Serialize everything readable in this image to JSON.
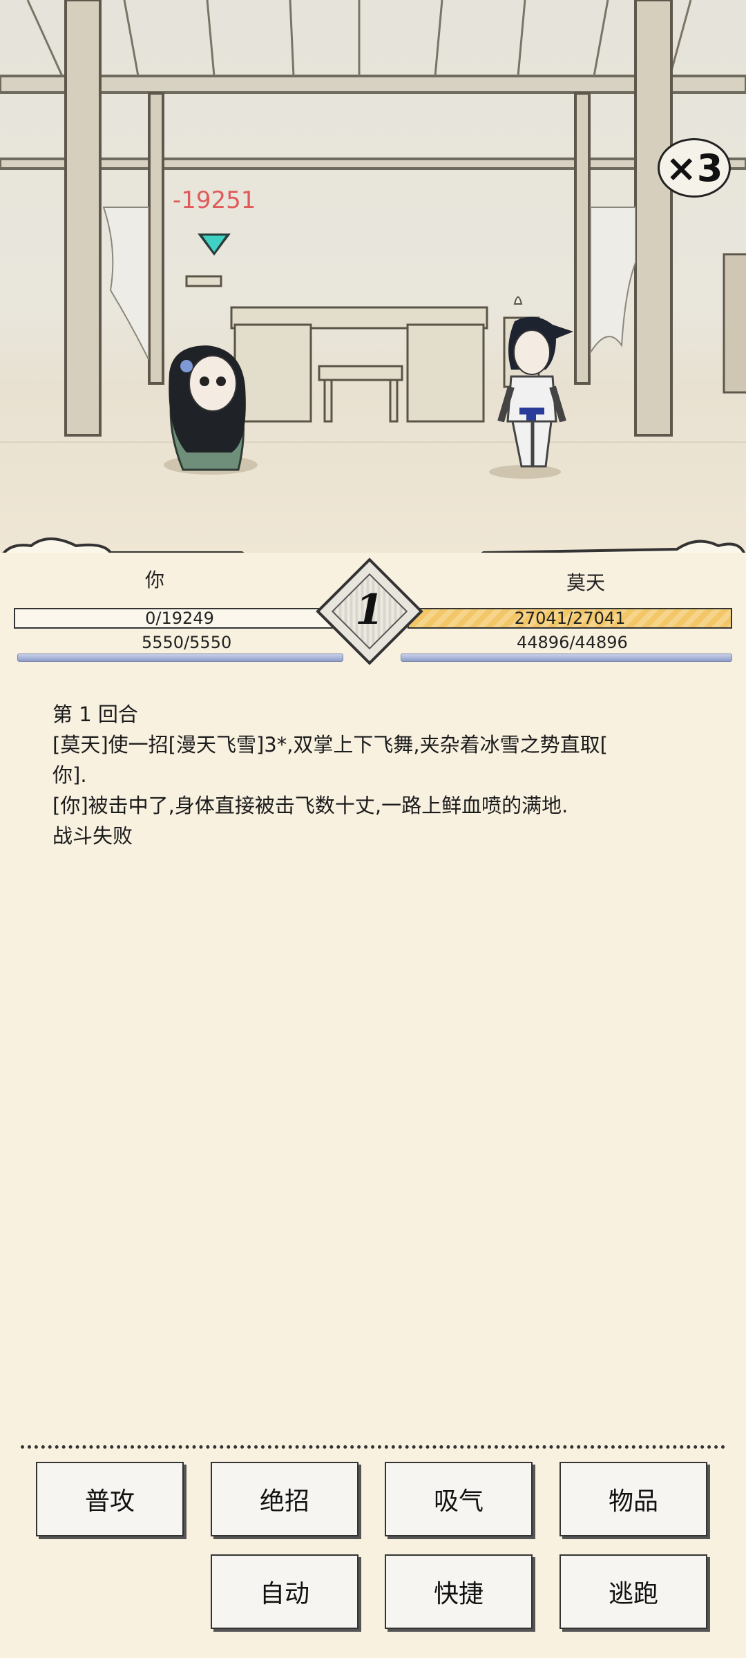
{
  "scene": {
    "speed_multiplier": "×3",
    "damage_popup": "-19251"
  },
  "player": {
    "name": "你",
    "hp": "0/19249",
    "mp": "5550/5550"
  },
  "enemy": {
    "name": "莫天",
    "hp": "27041/27041",
    "mp": "44896/44896"
  },
  "round": {
    "number": "1"
  },
  "log": {
    "lines": [
      "第 1 回合",
      "[莫天]使一招[漫天飞雪]3*,双掌上下飞舞,夹杂着冰雪之势直取[\n你].",
      "[你]被击中了,身体直接被击飞数十丈,一路上鲜血喷的满地.",
      "战斗失败"
    ]
  },
  "actions": {
    "attack": "普攻",
    "ultimate": "绝招",
    "breathe": "吸气",
    "items": "物品",
    "auto": "自动",
    "quick": "快捷",
    "flee": "逃跑"
  },
  "colors": {
    "background": "#f8f1e0",
    "damage": "#e05a5a",
    "enemy_hp": "#f3c768",
    "mp_bar": "#8d9dc9",
    "target_marker": "#3fd1c4"
  }
}
